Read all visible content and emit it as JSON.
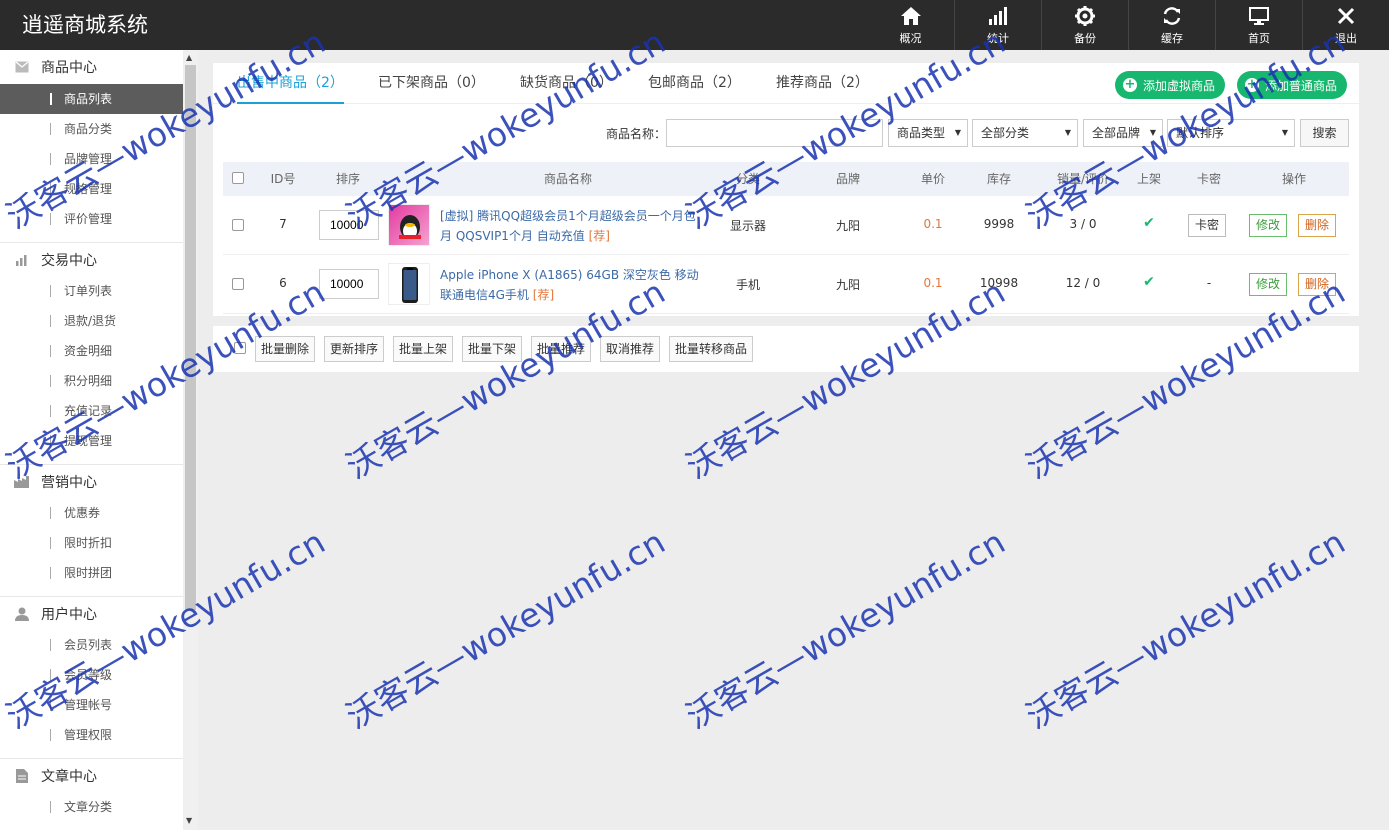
{
  "app": {
    "title": "逍遥商城系统"
  },
  "topnav": [
    {
      "label": "概况",
      "icon": "home-icon"
    },
    {
      "label": "统计",
      "icon": "bar-chart-icon"
    },
    {
      "label": "备份",
      "icon": "gear-icon"
    },
    {
      "label": "缓存",
      "icon": "refresh-icon"
    },
    {
      "label": "首页",
      "icon": "monitor-icon"
    },
    {
      "label": "退出",
      "icon": "close-icon"
    }
  ],
  "sidebar": {
    "groups": [
      {
        "title": "商品中心",
        "icon": "envelope-icon",
        "items": [
          "商品列表",
          "商品分类",
          "品牌管理",
          "规格管理",
          "评价管理"
        ]
      },
      {
        "title": "交易中心",
        "icon": "bar-chart-icon",
        "items": [
          "订单列表",
          "退款/退货",
          "资金明细",
          "积分明细",
          "充值记录",
          "提现管理"
        ]
      },
      {
        "title": "营销中心",
        "icon": "factory-icon",
        "items": [
          "优惠券",
          "限时折扣",
          "限时拼团"
        ]
      },
      {
        "title": "用户中心",
        "icon": "user-icon",
        "items": [
          "会员列表",
          "会员等级",
          "管理帐号",
          "管理权限"
        ]
      },
      {
        "title": "文章中心",
        "icon": "document-icon",
        "items": [
          "文章分类"
        ]
      }
    ],
    "active_item": "商品列表"
  },
  "tabs": [
    "出售中商品（2）",
    "已下架商品（0）",
    "缺货商品（0）",
    "包邮商品（2）",
    "推荐商品（2）"
  ],
  "actions": {
    "add_virtual": "添加虚拟商品",
    "add_normal": "添加普通商品"
  },
  "filter": {
    "name_label": "商品名称：",
    "name_value": "",
    "type_select": "商品类型",
    "category_select": "全部分类",
    "brand_select": "全部品牌",
    "sort_select": "默认排序",
    "search_label": "搜索"
  },
  "table": {
    "headers": [
      "ID号",
      "排序",
      "商品名称",
      "分类",
      "品牌",
      "单价",
      "库存",
      "销量/评价",
      "上架",
      "卡密",
      "操作"
    ],
    "rows": [
      {
        "id": "7",
        "sort": "10000",
        "name": "[虚拟] 腾讯QQ超级会员1个月超级会员一个月包月 QQSVIP1个月 自动充值",
        "tag": "[荐]",
        "category": "显示器",
        "brand": "九阳",
        "price": "0.1",
        "stock": "9998",
        "sales": "3 / 0",
        "on_shelf": "✔",
        "card": "卡密",
        "edit": "修改",
        "delete": "删除"
      },
      {
        "id": "6",
        "sort": "10000",
        "name": "Apple iPhone X (A1865) 64GB 深空灰色 移动联通电信4G手机",
        "tag": "[荐]",
        "category": "手机",
        "brand": "九阳",
        "price": "0.1",
        "stock": "10998",
        "sales": "12 / 0",
        "on_shelf": "✔",
        "card": "-",
        "edit": "修改",
        "delete": "删除"
      }
    ]
  },
  "batch": [
    "批量删除",
    "更新排序",
    "批量上架",
    "批量下架",
    "批量推荐",
    "取消推荐",
    "批量转移商品"
  ],
  "watermark": "沃客云—wokeyunfu.cn",
  "colors": {
    "topbar": "#2b2b2b",
    "accent": "#1aa2d8",
    "green": "#18b76f",
    "price": "#e4763a"
  }
}
